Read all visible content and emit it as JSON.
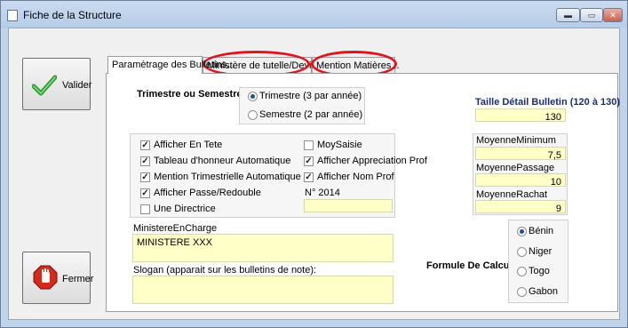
{
  "window": {
    "title": "Fiche de la Structure",
    "min_glyph": "▬",
    "max_glyph": "▭",
    "close_glyph": "✕"
  },
  "buttons": {
    "valider": "Valider",
    "fermer": "Fermer"
  },
  "tabs": [
    "Paramètrage des Bulletins...",
    "Ministère de tutelle/Devise",
    "Mention Matières..."
  ],
  "period": {
    "heading": "Trimestre ou Semestre ?",
    "options": [
      {
        "label": "Trimestre (3 par année)",
        "selected": true
      },
      {
        "label": "Semestre (2 par année)",
        "selected": false
      }
    ]
  },
  "taille": {
    "label": "Taille Détail Bulletin (120 à 130)",
    "value": "130"
  },
  "checks": [
    {
      "label": "Afficher En Tete",
      "checked": true
    },
    {
      "label": "Tableau d'honneur Automatique",
      "checked": true
    },
    {
      "label": "Mention Trimestrielle Automatique",
      "checked": true
    },
    {
      "label": "Afficher Passe/Redouble",
      "checked": true
    },
    {
      "label": "Une Directrice",
      "checked": false
    },
    {
      "label": "MoySaisie",
      "checked": false
    },
    {
      "label": "Afficher Appreciation Prof",
      "checked": true
    },
    {
      "label": "Afficher Nom Prof",
      "checked": true
    }
  ],
  "n2014": {
    "label": "N° 2014",
    "value": ""
  },
  "moyennes": [
    {
      "label": "MoyenneMinimum",
      "value": "7,5"
    },
    {
      "label": "MoyennePassage",
      "value": "10"
    },
    {
      "label": "MoyenneRachat",
      "value": "9"
    }
  ],
  "ministere": {
    "label": "MinistereEnCharge",
    "value": "MINISTERE XXX"
  },
  "slogan": {
    "label": "Slogan (apparait sur les bulletins de note):",
    "value": ""
  },
  "formule": {
    "label": "Formule De Calcule",
    "options": [
      {
        "label": "Bénin",
        "selected": true
      },
      {
        "label": "Niger",
        "selected": false
      },
      {
        "label": "Togo",
        "selected": false
      },
      {
        "label": "Gabon",
        "selected": false
      }
    ]
  },
  "colors": {
    "highlight": "#e0141e",
    "field": "#ffffc8",
    "accent_text": "#1a2f6b"
  },
  "icons": [
    "app-icon",
    "checkmark-icon",
    "stop-hand-icon"
  ]
}
